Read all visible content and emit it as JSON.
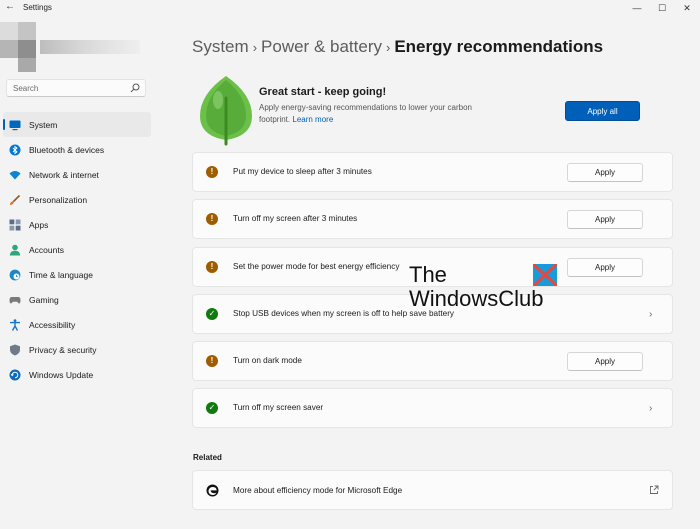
{
  "window": {
    "title": "Settings",
    "back_icon": "back-arrow-icon",
    "minimize_glyph": "—",
    "maximize_glyph": "☐",
    "close_glyph": "✕"
  },
  "search": {
    "placeholder": "Search"
  },
  "sidebar": {
    "items": [
      {
        "label": "System",
        "icon": "system-icon",
        "active": true,
        "color": "#0067c0"
      },
      {
        "label": "Bluetooth & devices",
        "icon": "bluetooth-icon",
        "active": false,
        "color": "#0078d4"
      },
      {
        "label": "Network & internet",
        "icon": "wifi-icon",
        "active": false,
        "color": "#0a84d6"
      },
      {
        "label": "Personalization",
        "icon": "paintbrush-icon",
        "active": false,
        "color": "#d87a2b"
      },
      {
        "label": "Apps",
        "icon": "apps-icon",
        "active": false,
        "color": "#5b6e86"
      },
      {
        "label": "Accounts",
        "icon": "person-icon",
        "active": false,
        "color": "#2ea67d"
      },
      {
        "label": "Time & language",
        "icon": "globe-clock-icon",
        "active": false,
        "color": "#1a88c9"
      },
      {
        "label": "Gaming",
        "icon": "gamepad-icon",
        "active": false,
        "color": "#6b6b6b"
      },
      {
        "label": "Accessibility",
        "icon": "accessibility-icon",
        "active": false,
        "color": "#1875c9"
      },
      {
        "label": "Privacy & security",
        "icon": "shield-icon",
        "active": false,
        "color": "#707b8a"
      },
      {
        "label": "Windows Update",
        "icon": "update-icon",
        "active": false,
        "color": "#0f6cbd"
      }
    ]
  },
  "breadcrumb": {
    "items": [
      "System",
      "Power & battery"
    ],
    "separator": "›",
    "current": "Energy recommendations"
  },
  "hero": {
    "icon": "leaf-icon",
    "title": "Great start - keep going!",
    "description": "Apply energy-saving recommendations to lower your carbon footprint.",
    "link": "Learn more",
    "apply_all_label": "Apply all"
  },
  "recommendations": [
    {
      "label": "Put my device to sleep after 3 minutes",
      "status": "warning",
      "action": "Apply"
    },
    {
      "label": "Turn off my screen after 3 minutes",
      "status": "warning",
      "action": "Apply"
    },
    {
      "label": "Set the power mode for best energy efficiency",
      "status": "warning",
      "action": "Apply"
    },
    {
      "label": "Stop USB devices when my screen is off to help save battery",
      "status": "done",
      "action": ""
    },
    {
      "label": "Turn on dark mode",
      "status": "warning",
      "action": "Apply"
    },
    {
      "label": "Turn off my screen saver",
      "status": "done",
      "action": ""
    }
  ],
  "status_glyphs": {
    "warning": "!",
    "done": "✓"
  },
  "related": {
    "heading": "Related",
    "items": [
      {
        "label": "More about efficiency mode for Microsoft Edge",
        "icon": "edge-icon",
        "trailing_icon": "external-link-icon"
      }
    ]
  },
  "watermark": {
    "line1": "The",
    "line2": "WindowsClub"
  },
  "colors": {
    "accent": "#005fb8",
    "warning": "#9d5d00",
    "success": "#0f7b0f",
    "leaf": "#6cc04a"
  }
}
